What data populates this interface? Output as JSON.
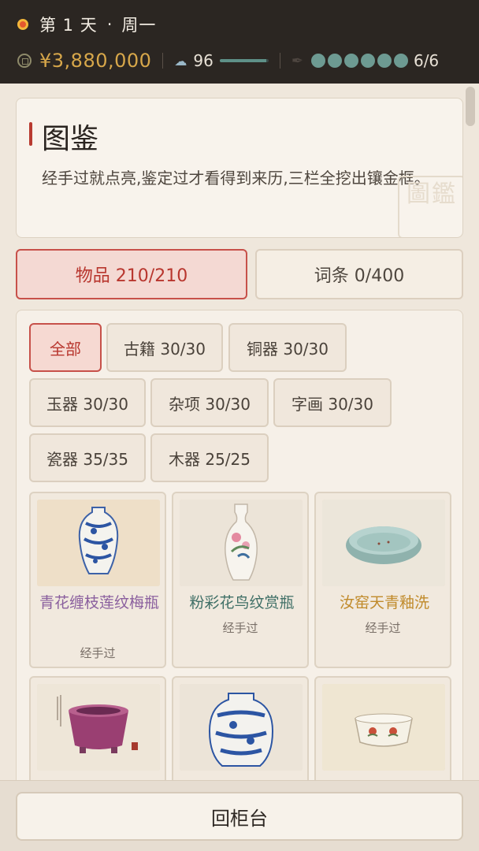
{
  "status": {
    "day_label": "第 1 天",
    "separator": "·",
    "weekday": "周一",
    "money": "¥3,880,000",
    "reputation": "96",
    "reputation_fraction": 0.96,
    "energy_total": 6,
    "energy_current": 6,
    "energy_text": "6/6"
  },
  "intro": {
    "title": "图鉴",
    "description": "经手过就点亮,鉴定过才看得到来历,三栏全挖出镶金框。",
    "watermark": "圖鑑"
  },
  "tabs": {
    "items": "物品 210/210",
    "terms": "词条 0/400"
  },
  "filters": [
    "全部",
    "古籍 30/30",
    "铜器 30/30",
    "玉器 30/30",
    "杂项 30/30",
    "字画 30/30",
    "瓷器 35/35",
    "木器 25/25"
  ],
  "items": [
    {
      "name": "青花缠枝莲纹梅瓶",
      "status": "经手过",
      "color": "#8a5f9e"
    },
    {
      "name": "粉彩花鸟纹赏瓶",
      "status": "经手过",
      "color": "#3f6f66"
    },
    {
      "name": "汝窑天青釉洗",
      "status": "经手过",
      "color": "#c08a2a"
    },
    {
      "name": "",
      "status": ""
    },
    {
      "name": "",
      "status": ""
    },
    {
      "name": "",
      "status": ""
    }
  ],
  "bottom": {
    "back_label": "回柜台"
  },
  "colors": {
    "accent_red": "#b8362e",
    "gold": "#d7a74a",
    "teal": "#6d9a92"
  }
}
